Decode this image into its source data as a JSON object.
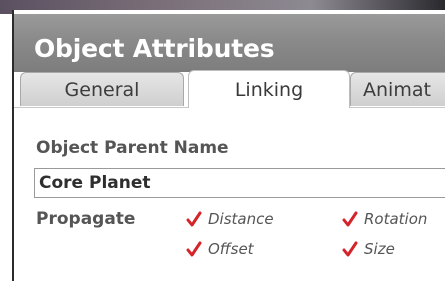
{
  "window": {
    "title": "Object Attributes"
  },
  "tabs": [
    {
      "label": "General",
      "active": false
    },
    {
      "label": "Linking",
      "active": true
    },
    {
      "label": "Animat",
      "active": false
    }
  ],
  "linking": {
    "parent_label": "Object Parent Name",
    "parent_value": "Core Planet",
    "propagate_label": "Propagate",
    "options": [
      {
        "label": "Distance",
        "checked": true
      },
      {
        "label": "Rotation",
        "checked": true
      },
      {
        "label": "Offset",
        "checked": true
      },
      {
        "label": "Size",
        "checked": true
      }
    ]
  },
  "colors": {
    "titlebar": "#8a8a8a",
    "check": "#d4242a"
  },
  "icons": {
    "checkmark": "checkmark-icon"
  }
}
